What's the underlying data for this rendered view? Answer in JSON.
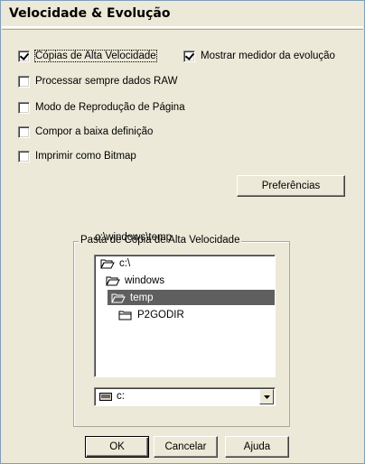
{
  "window": {
    "title": "Velocidade & Evolução"
  },
  "options": [
    {
      "id": "fast_copies",
      "label": "Cópias de Alta Velocidade",
      "checked": true
    },
    {
      "id": "show_progress",
      "label": "Mostrar medidor da evolução",
      "checked": true
    },
    {
      "id": "raw",
      "label": "Processar sempre dados RAW",
      "checked": false
    },
    {
      "id": "page_mode",
      "label": "Modo de Reprodução de Página",
      "checked": false
    },
    {
      "id": "low_res",
      "label": "Compor a baixa definição",
      "checked": false
    },
    {
      "id": "bitmap",
      "label": "Imprimir como Bitmap",
      "checked": false
    }
  ],
  "buttons": {
    "preferences": "Preferências",
    "ok": "OK",
    "cancel": "Cancelar",
    "help": "Ajuda"
  },
  "copy_folder": {
    "group_label": "Pasta de Cópia de Alta Velocidade",
    "current_path": "c:\\windows\\temp",
    "tree": [
      {
        "label": "c:\\",
        "level": 0,
        "state": "open",
        "selected": false
      },
      {
        "label": "windows",
        "level": 1,
        "state": "open",
        "selected": false
      },
      {
        "label": "temp",
        "level": 2,
        "state": "open",
        "selected": true
      },
      {
        "label": "P2GODIR",
        "level": 3,
        "state": "closed",
        "selected": false
      }
    ],
    "drive": {
      "selected": "c:",
      "icon": "drive-icon"
    }
  },
  "colors": {
    "dialog_bg": "#ece9d8",
    "selection": "#5f5f5f"
  }
}
